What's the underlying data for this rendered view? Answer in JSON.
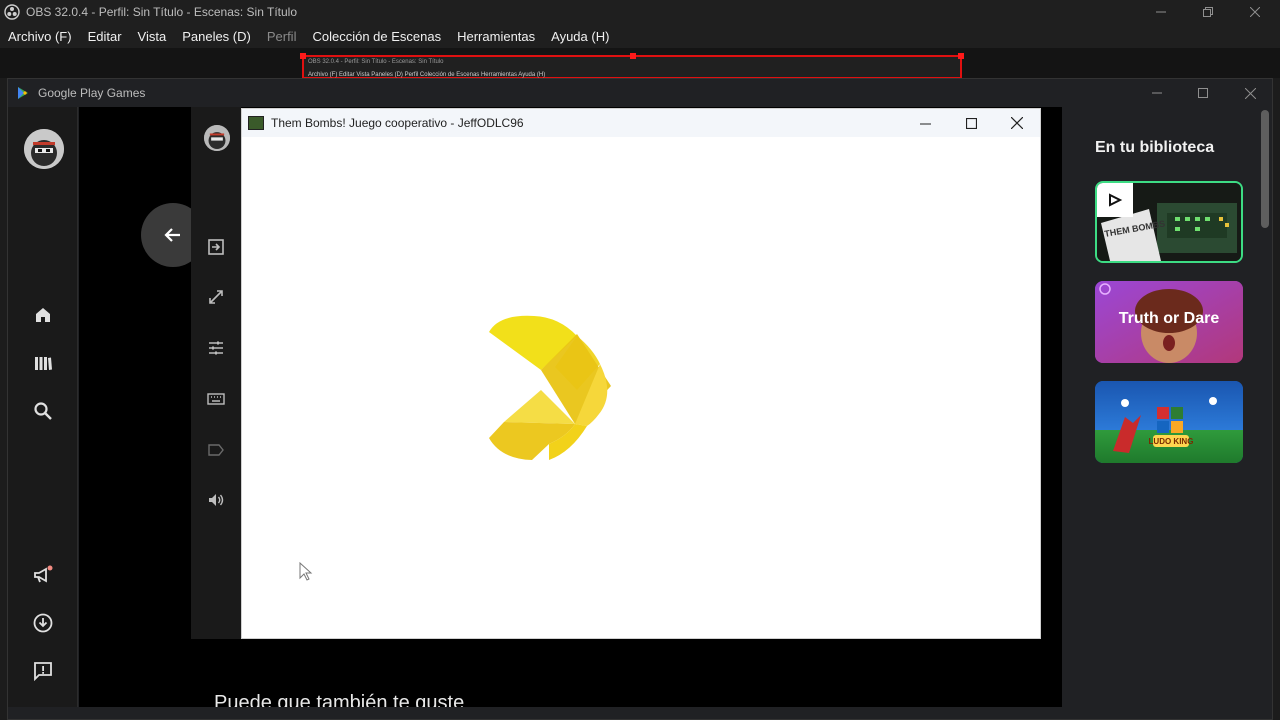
{
  "obs": {
    "title": "OBS 32.0.4 - Perfil: Sin Título - Escenas: Sin Título",
    "menu": [
      {
        "label": "Archivo (F)"
      },
      {
        "label": "Editar"
      },
      {
        "label": "Vista"
      },
      {
        "label": "Paneles (D)"
      },
      {
        "label": "Perfil"
      },
      {
        "label": "Colección de Escenas"
      },
      {
        "label": "Herramientas"
      },
      {
        "label": "Ayuda (H)"
      }
    ],
    "preview": {
      "nested_title": "OBS 32.0.4 - Perfil: Sin Título - Escenas: Sin Título",
      "nested_menu": "Archivo (F)   Editar   Vista   Paneles (D)   Perfil   Colección de Escenas   Herramientas   Ayuda (H)",
      "selection_color": "#e01010"
    }
  },
  "gpg": {
    "title": "Google Play Games",
    "sidebar_icons": [
      "avatar",
      "home-icon",
      "library-icon",
      "search-icon",
      "announcements-icon",
      "downloads-icon",
      "feedback-icon"
    ],
    "toolbar_icons": [
      "avatar",
      "exit-icon",
      "fullscreen-icon",
      "settings-sliders-icon",
      "keyboard-icon",
      "label-icon",
      "volume-icon"
    ],
    "game_window": {
      "title": "Them Bombs! Juego cooperativo - JeffODLC96"
    },
    "suggest_text": "Puede que también te guste",
    "library": {
      "title": "En tu biblioteca",
      "cards": [
        {
          "name": "Them Bombs",
          "label": "THEM BOMBS",
          "color": "#2a3b2a",
          "selected": true
        },
        {
          "name": "Truth or Dare",
          "label": "Truth or Dare",
          "color": "#8a3fc9"
        },
        {
          "name": "Ludo King",
          "label": "LUDO KING",
          "color": "#1d5fb8"
        }
      ]
    },
    "colors": {
      "accent_green": "#3ddc84",
      "logo_yellow": "#f2d21a"
    }
  }
}
